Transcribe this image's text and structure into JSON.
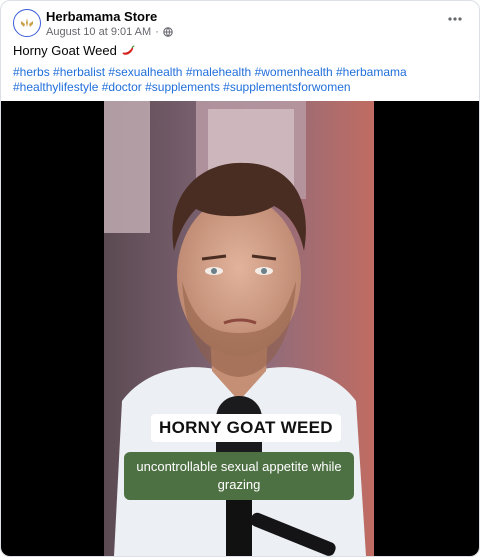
{
  "post": {
    "page_name": "Herbamama Store",
    "timestamp": "August 10 at 9:01 AM",
    "separator": "·",
    "audience_icon": "globe-icon",
    "text": "Horny Goat Weed",
    "emoji": "chili-pepper-icon",
    "hashtags": [
      "#herbs",
      "#herbalist",
      "#sexualhealth",
      "#malehealth",
      "#womenhealth",
      "#herbamama",
      "#healthylifestyle",
      "#doctor",
      "#supplements",
      "#supplementsforwomen"
    ]
  },
  "video": {
    "caption_title": "HORNY GOAT WEED",
    "caption_subtitle": "uncontrollable sexual appetite while grazing"
  },
  "colors": {
    "link": "#216fdb",
    "caption_green": "#4e7144"
  }
}
